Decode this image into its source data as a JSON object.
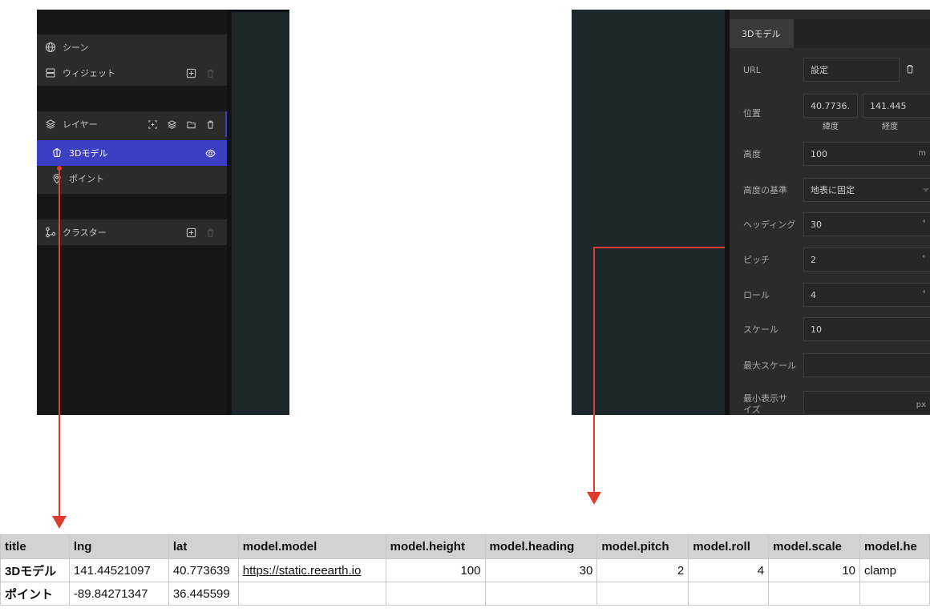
{
  "left_panel": {
    "scene_label": "シーン",
    "widget_label": "ウィジェット",
    "layer_label": "レイヤー",
    "layer_items": [
      {
        "label": "3Dモデル",
        "selected": true
      },
      {
        "label": "ポイント",
        "selected": false
      }
    ],
    "cluster_label": "クラスター"
  },
  "right_panel": {
    "tab": "3Dモデル",
    "url": {
      "label": "URL",
      "value": "設定"
    },
    "position": {
      "label": "位置",
      "lat_value": "40.7736.",
      "lng_value": "141.445",
      "lat_caption": "緯度",
      "lng_caption": "経度"
    },
    "height": {
      "label": "高度",
      "value": "100",
      "unit": "m"
    },
    "height_ref": {
      "label": "高度の基準",
      "value": "地表に固定"
    },
    "heading": {
      "label": "ヘッディング",
      "value": "30",
      "unit": "°"
    },
    "pitch": {
      "label": "ピッチ",
      "value": "2",
      "unit": "°"
    },
    "roll": {
      "label": "ロール",
      "value": "4",
      "unit": "°"
    },
    "scale": {
      "label": "スケール",
      "value": "10"
    },
    "max_scale": {
      "label": "最大スケール",
      "value": ""
    },
    "min_size": {
      "label": "最小表示サイズ",
      "value": "",
      "unit": "px"
    }
  },
  "table": {
    "headers": [
      "title",
      "lng",
      "lat",
      "model.model",
      "model.height",
      "model.heading",
      "model.pitch",
      "model.roll",
      "model.scale",
      "model.he"
    ],
    "rows": [
      [
        "3Dモデル",
        "141.44521097",
        "40.773639",
        "https://static.reearth.io",
        "100",
        "30",
        "2",
        "4",
        "10",
        "clamp"
      ],
      [
        "ポイント",
        "-89.84271347",
        "36.445599",
        "",
        "",
        "",
        "",
        "",
        "",
        ""
      ]
    ]
  },
  "colors": {
    "accent": "#3b3fc2",
    "arrow": "#e03b2f",
    "map_bg": "#1c272c"
  }
}
